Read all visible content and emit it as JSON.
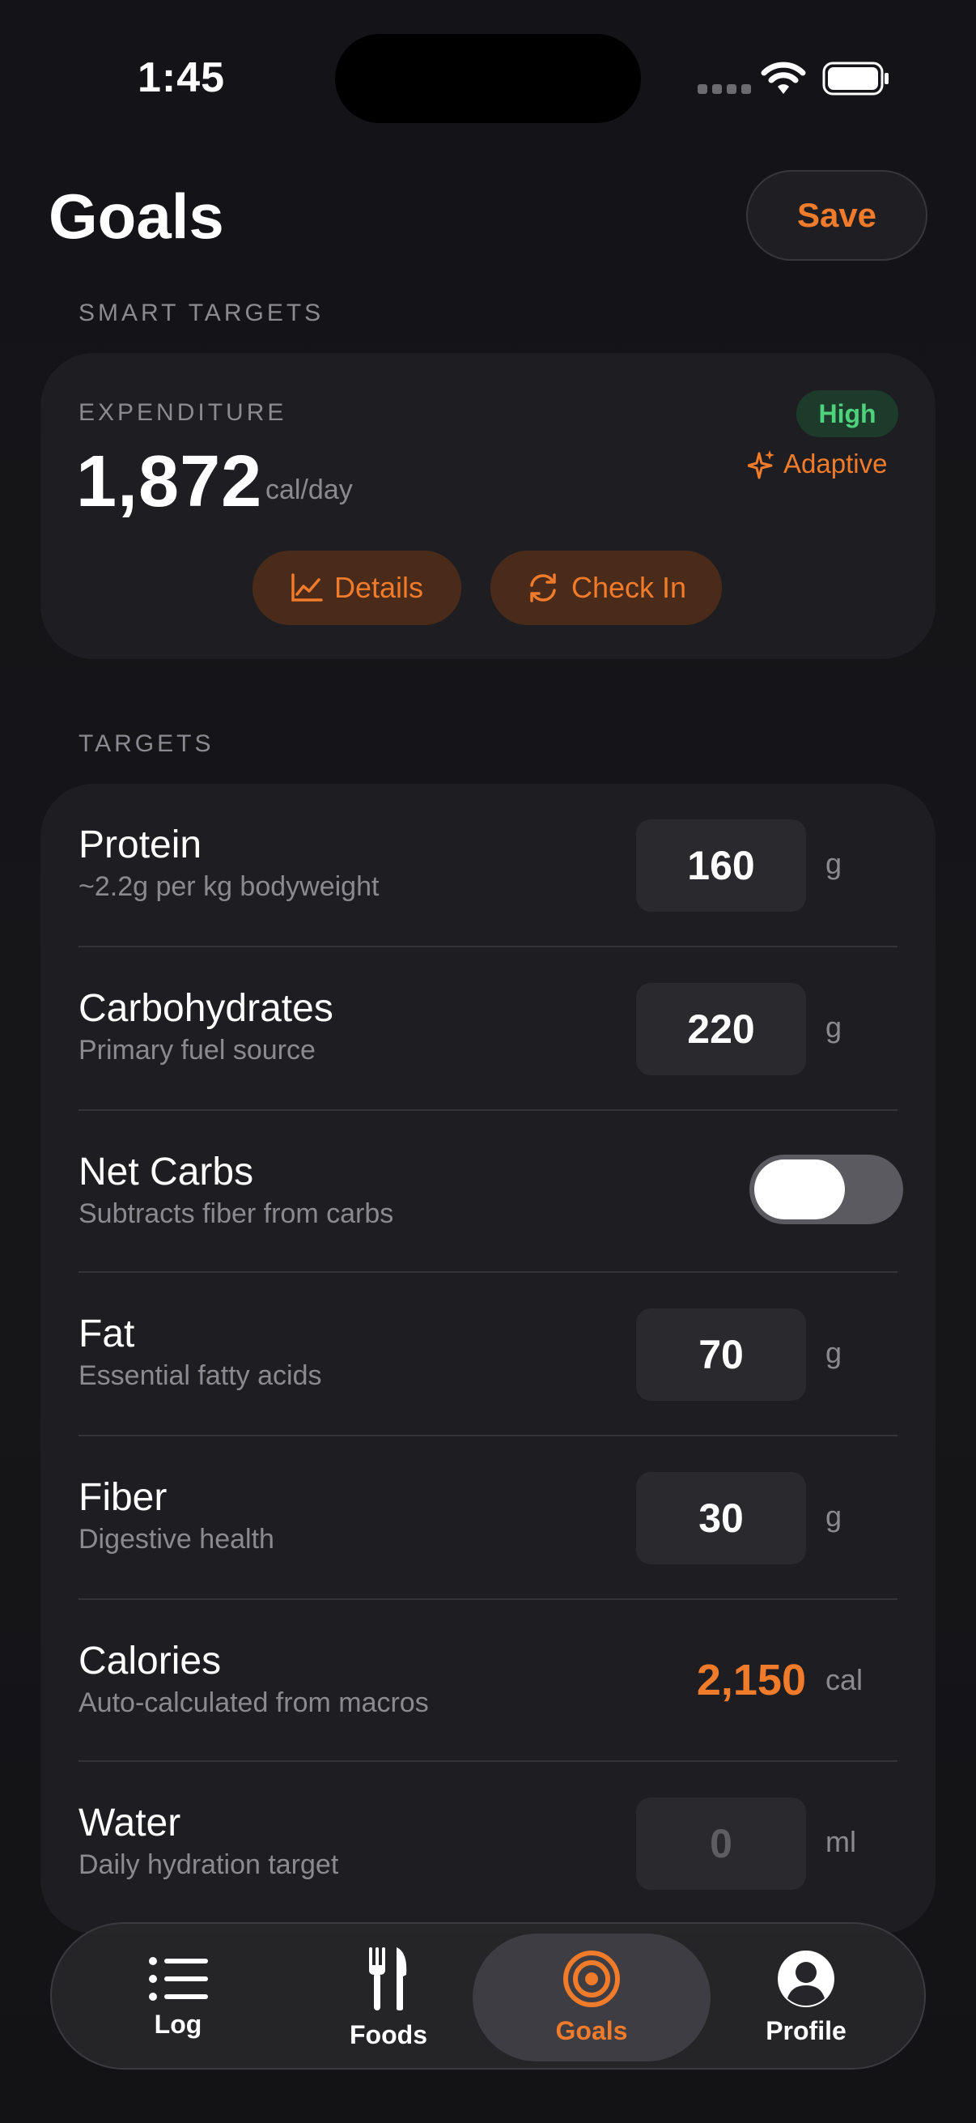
{
  "status_bar": {
    "time": "1:45"
  },
  "header": {
    "title": "Goals",
    "save_label": "Save"
  },
  "smart_targets": {
    "section_label": "SMART TARGETS",
    "expenditure_label": "EXPENDITURE",
    "value": "1,872",
    "unit": "cal/day",
    "badge": "High",
    "mode": "Adaptive",
    "details_label": "Details",
    "checkin_label": "Check In"
  },
  "targets": {
    "section_label": "TARGETS",
    "rows": [
      {
        "name": "Protein",
        "desc": "~2.2g per kg bodyweight",
        "value": "160",
        "unit": "g"
      },
      {
        "name": "Carbohydrates",
        "desc": "Primary fuel source",
        "value": "220",
        "unit": "g"
      },
      {
        "name": "Net Carbs",
        "desc": "Subtracts fiber from carbs"
      },
      {
        "name": "Fat",
        "desc": "Essential fatty acids",
        "value": "70",
        "unit": "g"
      },
      {
        "name": "Fiber",
        "desc": "Digestive health",
        "value": "30",
        "unit": "g"
      },
      {
        "name": "Calories",
        "desc": "Auto-calculated from macros",
        "value": "2,150",
        "unit": "cal"
      },
      {
        "name": "Water",
        "desc": "Daily hydration target",
        "value": "0",
        "unit": "ml"
      }
    ]
  },
  "tabbar": {
    "tabs": [
      {
        "label": "Log",
        "icon": "list-icon"
      },
      {
        "label": "Foods",
        "icon": "fork-knife-icon"
      },
      {
        "label": "Goals",
        "icon": "target-icon"
      },
      {
        "label": "Profile",
        "icon": "person-circle-icon"
      }
    ],
    "active": "Goals"
  },
  "colors": {
    "accent": "#f07b2a",
    "success": "#4fd27d",
    "background": "#131316",
    "card": "#1e1e22"
  }
}
